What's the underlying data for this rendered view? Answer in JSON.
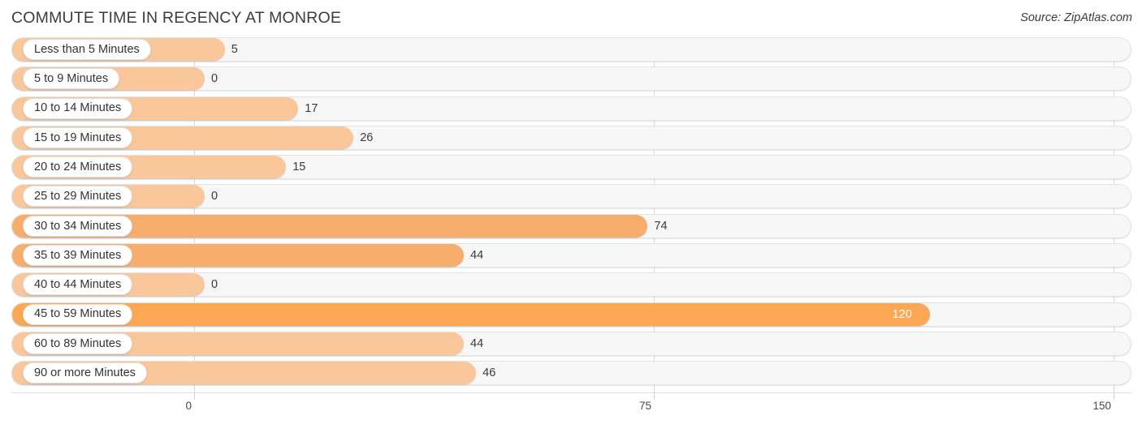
{
  "header": {
    "title": "COMMUTE TIME IN REGENCY AT MONROE",
    "source": "Source: ZipAtlas.com"
  },
  "axis": {
    "ticks": [
      "0",
      "75",
      "150"
    ]
  },
  "colors": {
    "bar_light": "#fac79a",
    "bar_mid": "#f7ae6d",
    "bar_dark": "#fca754",
    "track": "#f7f7f7",
    "gridline": "#d9d9d9",
    "text": "#3c3c3c",
    "value_inside": "#ffffff"
  },
  "chart_data": {
    "type": "bar",
    "orientation": "horizontal",
    "title": "COMMUTE TIME IN REGENCY AT MONROE",
    "xlabel": "",
    "ylabel": "",
    "xlim": [
      0,
      150
    ],
    "xticks": [
      0,
      75,
      150
    ],
    "grid": true,
    "legend": null,
    "categories": [
      "Less than 5 Minutes",
      "5 to 9 Minutes",
      "10 to 14 Minutes",
      "15 to 19 Minutes",
      "20 to 24 Minutes",
      "25 to 29 Minutes",
      "30 to 34 Minutes",
      "35 to 39 Minutes",
      "40 to 44 Minutes",
      "45 to 59 Minutes",
      "60 to 89 Minutes",
      "90 or more Minutes"
    ],
    "values": [
      5,
      0,
      17,
      26,
      15,
      0,
      74,
      44,
      0,
      120,
      44,
      46
    ],
    "value_labels": [
      "5",
      "0",
      "17",
      "26",
      "15",
      "0",
      "74",
      "44",
      "0",
      "120",
      "44",
      "46"
    ]
  },
  "rows": [
    {
      "label": "Less than 5 Minutes",
      "value": 5,
      "value_label": "5",
      "shade": "light",
      "label_inside": false
    },
    {
      "label": "5 to 9 Minutes",
      "value": 0,
      "value_label": "0",
      "shade": "light",
      "label_inside": false
    },
    {
      "label": "10 to 14 Minutes",
      "value": 17,
      "value_label": "17",
      "shade": "light",
      "label_inside": false
    },
    {
      "label": "15 to 19 Minutes",
      "value": 26,
      "value_label": "26",
      "shade": "light",
      "label_inside": false
    },
    {
      "label": "20 to 24 Minutes",
      "value": 15,
      "value_label": "15",
      "shade": "light",
      "label_inside": false
    },
    {
      "label": "25 to 29 Minutes",
      "value": 0,
      "value_label": "0",
      "shade": "light",
      "label_inside": false
    },
    {
      "label": "30 to 34 Minutes",
      "value": 74,
      "value_label": "74",
      "shade": "mid",
      "label_inside": false
    },
    {
      "label": "35 to 39 Minutes",
      "value": 44,
      "value_label": "44",
      "shade": "mid",
      "label_inside": false
    },
    {
      "label": "40 to 44 Minutes",
      "value": 0,
      "value_label": "0",
      "shade": "light",
      "label_inside": false
    },
    {
      "label": "45 to 59 Minutes",
      "value": 120,
      "value_label": "120",
      "shade": "dark",
      "label_inside": true
    },
    {
      "label": "60 to 89 Minutes",
      "value": 44,
      "value_label": "44",
      "shade": "light",
      "label_inside": false
    },
    {
      "label": "90 or more Minutes",
      "value": 46,
      "value_label": "46",
      "shade": "light",
      "label_inside": false
    }
  ]
}
